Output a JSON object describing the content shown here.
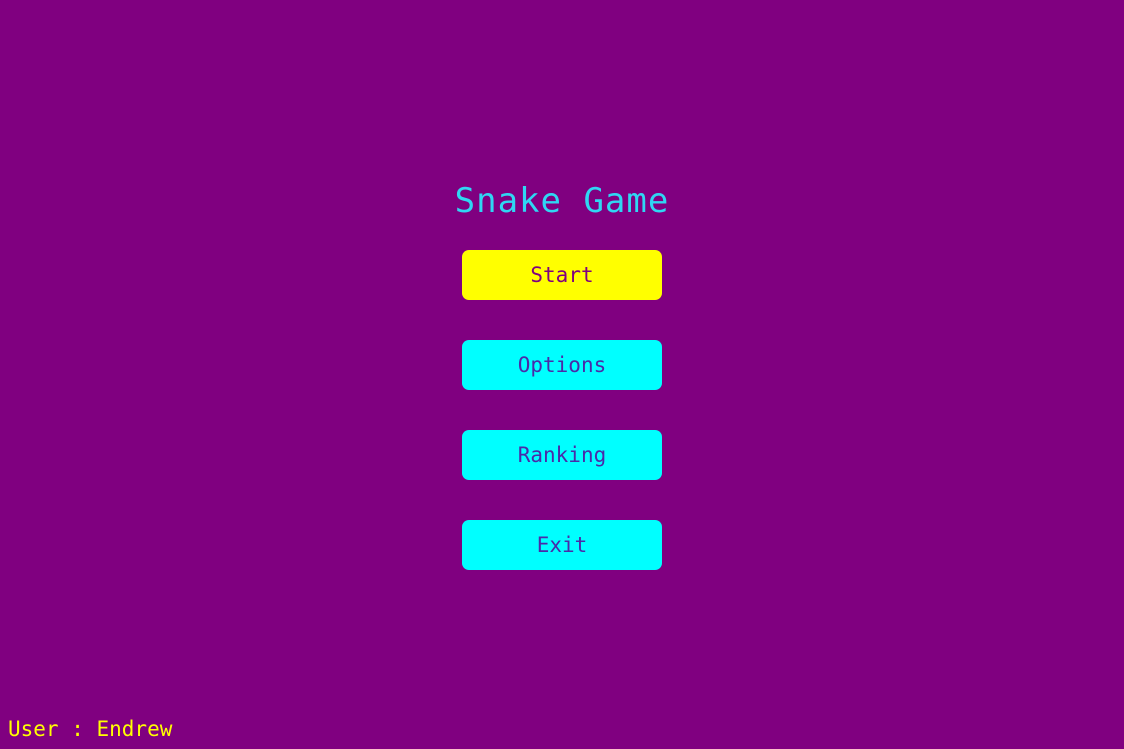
{
  "game": {
    "title": "Snake Game"
  },
  "menu": {
    "selected_index": 0,
    "items": [
      {
        "label": "Start"
      },
      {
        "label": "Options"
      },
      {
        "label": "Ranking"
      },
      {
        "label": "Exit"
      }
    ]
  },
  "user": {
    "label": "User : Endrew"
  },
  "colors": {
    "background": "#800080",
    "title": "#2fd7f3",
    "button": "#00ffff",
    "button_selected": "#ffff00",
    "button_text": "#4b2aa8",
    "button_selected_text": "#800080",
    "user_text": "#ffff00"
  }
}
